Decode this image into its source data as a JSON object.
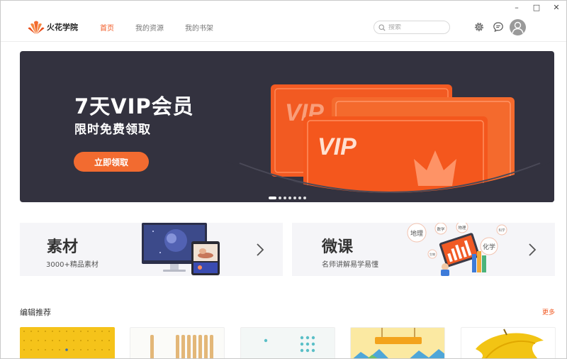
{
  "window": {
    "minimize": "–",
    "maximize": "□",
    "close": "✕"
  },
  "header": {
    "brand": "火花学院",
    "nav": [
      {
        "label": "首页",
        "active": true
      },
      {
        "label": "我的资源",
        "active": false
      },
      {
        "label": "我的书架",
        "active": false
      }
    ],
    "search_placeholder": "搜索",
    "icons": [
      "settings-icon",
      "message-icon",
      "avatar"
    ]
  },
  "banner": {
    "title": "7天VIP会员",
    "subtitle": "限时免费领取",
    "button": "立即领取",
    "card_text_back": "VIP",
    "card_text_front": "VIP",
    "slides": 7,
    "active_slide": 0
  },
  "cards": [
    {
      "title": "素材",
      "desc": "3000+精品素材"
    },
    {
      "title": "微课",
      "desc": "名师讲解易学易懂",
      "bubbles": [
        "地理",
        "数学",
        "物理",
        "化学",
        "科学",
        "生物"
      ]
    }
  ],
  "section": {
    "title": "编辑推荐",
    "more": "更多"
  },
  "colors": {
    "accent": "#f15a24",
    "banner_bg": "#33323f",
    "card_bg": "#f5f5f8"
  }
}
